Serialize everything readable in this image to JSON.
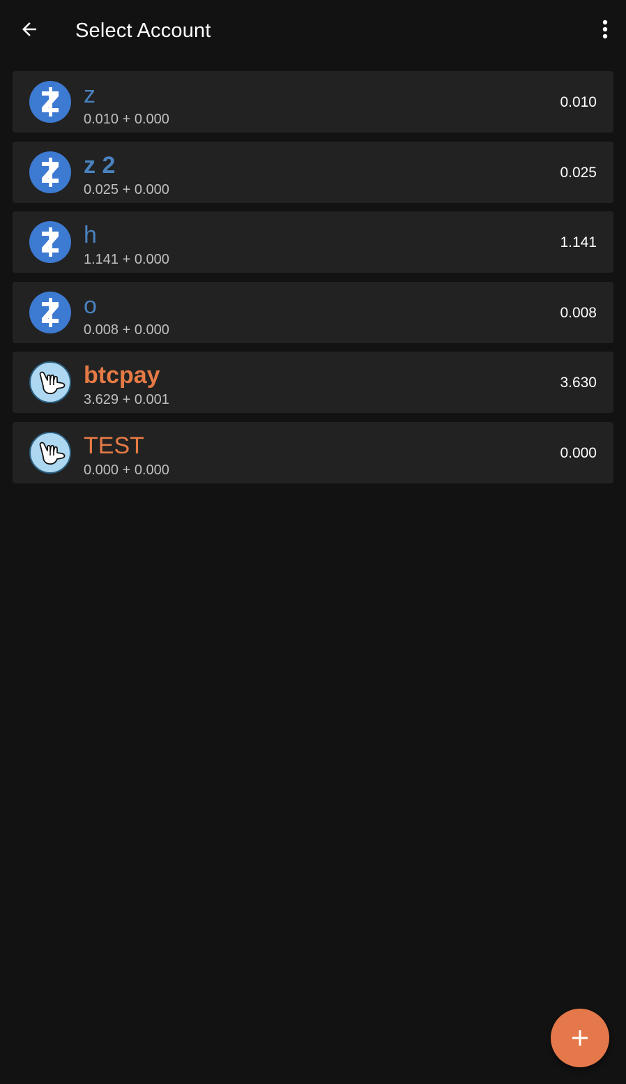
{
  "appbar": {
    "title": "Select Account",
    "back_icon": "arrow-left-icon",
    "menu_icon": "more-vert-icon"
  },
  "colors": {
    "background": "#121212",
    "card": "#222222",
    "zcash_accent": "#4a82bf",
    "ycash_accent": "#e57a45",
    "fab": "#e4784a"
  },
  "accounts": [
    {
      "name": "z",
      "coin": "zcash",
      "icon": "zcash-logo-icon",
      "detail_a": "0.010",
      "detail_b": "0.000",
      "balance": "0.010"
    },
    {
      "name": "z 2",
      "coin": "zcash",
      "icon": "zcash-logo-icon",
      "detail_a": "0.025",
      "detail_b": "0.000",
      "balance": "0.025"
    },
    {
      "name": "h",
      "coin": "zcash",
      "icon": "zcash-logo-icon",
      "detail_a": "1.141",
      "detail_b": "0.000",
      "balance": "1.141"
    },
    {
      "name": "o",
      "coin": "zcash",
      "icon": "zcash-logo-icon",
      "detail_a": "0.008",
      "detail_b": "0.000",
      "balance": "0.008"
    },
    {
      "name": "btcpay",
      "coin": "ycash",
      "icon": "ycash-logo-icon",
      "detail_a": "3.629",
      "detail_b": "0.001",
      "balance": "3.630"
    },
    {
      "name": "TEST",
      "coin": "ycash",
      "icon": "ycash-logo-icon",
      "detail_a": "0.000",
      "detail_b": "0.000",
      "balance": "0.000"
    }
  ],
  "separator": "+",
  "fab": {
    "icon": "plus-icon"
  }
}
